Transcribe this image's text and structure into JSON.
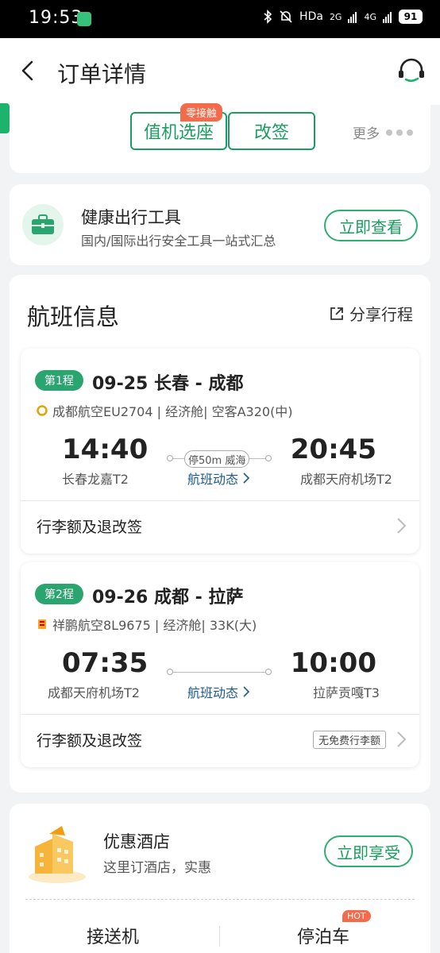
{
  "status_bar": {
    "time": "19:53",
    "hd": "HDa",
    "net1": "2G",
    "net2": "4G",
    "battery": "91"
  },
  "header": {
    "title": "订单详情"
  },
  "actions": {
    "badge": "零接触",
    "seat_label": "值机选座",
    "change_label": "改签",
    "more_label": "更多"
  },
  "health": {
    "title": "健康出行工具",
    "subtitle": "国内/国际出行安全工具一站式汇总",
    "button": "立即查看"
  },
  "flight": {
    "title": "航班信息",
    "share": "分享行程",
    "legs": [
      {
        "tag": "第1程",
        "route": "09-25 长春 - 成都",
        "airline": "成都航空EU2704 | 经济舱| 空客A320(中)",
        "dep_time": "14:40",
        "dep_airport": "长春龙嘉T2",
        "stop": "停50m 威海",
        "dynamics": "航班动态",
        "arr_time": "20:45",
        "arr_airport": "成都天府机场T2",
        "baggage": "行李额及退改签"
      },
      {
        "tag": "第2程",
        "route": "09-26 成都 - 拉萨",
        "airline": "祥鹏航空8L9675 | 经济舱| 33K(大)",
        "dep_time": "07:35",
        "dep_airport": "成都天府机场T2",
        "dynamics": "航班动态",
        "arr_time": "10:00",
        "arr_airport": "拉萨贡嘎T3",
        "baggage": "行李额及退改签",
        "baggage_note": "无免费行李额"
      }
    ]
  },
  "hotel": {
    "title": "优惠酒店",
    "subtitle": "这里订酒店，实惠",
    "button": "立即享受",
    "services": {
      "pickup": "接送机",
      "parking": "停泊车",
      "hot": "HOT"
    }
  },
  "colors": {
    "brand_green": "#1a9e60",
    "accent_orange": "#f36b4a"
  }
}
